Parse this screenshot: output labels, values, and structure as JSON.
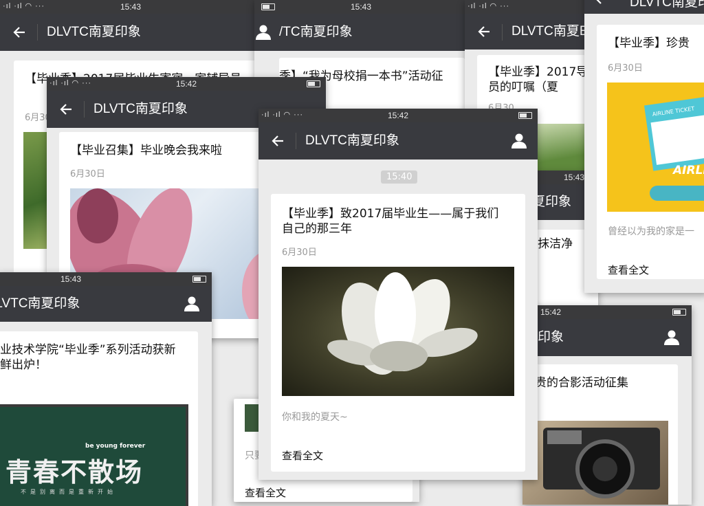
{
  "app": {
    "account_name": "DLVTC南夏印象",
    "account_name_cut": "/TC南夏印象",
    "account_name_cut2": "/LVTC南夏印象",
    "account_name_cut3": "DLVTC南夏E",
    "account_name_cut4": "DLVTC南夏印",
    "account_name_cut5": "夏印象",
    "account_name_cut6": "印象"
  },
  "status_times": {
    "a": "15:43",
    "b": "15:43",
    "c": "15:42",
    "d": "15:42",
    "e": "15:43",
    "f": "15:43",
    "g": "15:42"
  },
  "status_signal": "·ıl ·ıl ◠ ···",
  "main_screen": {
    "message_time": "15:40",
    "article": {
      "title": "【毕业季】致2017届毕业生——属于我们自己的那三年",
      "date": "6月30日",
      "summary": "你和我的夏天~",
      "read_more": "查看全文"
    }
  },
  "screen_left_mid": {
    "article": {
      "title": "【毕业召集】毕业晚会我来啦",
      "date": "6月30日"
    }
  },
  "screen_top_left": {
    "article": {
      "title": "【毕业季】2017届毕业生寄宿一家辅导员",
      "date": "6月30"
    }
  },
  "screen_top_center": {
    "article": {
      "title": "季】“我为母校捐一本书”活动征"
    }
  },
  "screen_top_right": {
    "article": {
      "title": "【毕业季】2017导员的叮嘱（夏",
      "date": "6月30"
    }
  },
  "screen_far_right": {
    "article": {
      "title": "【毕业季】珍贵",
      "date": "6月30日",
      "summary": "曾经以为我的家是一",
      "read_more": "查看全文",
      "ticket_label": "AIRLINE TICKET",
      "ticket_word": "AIRLI"
    }
  },
  "screen_bottom_left": {
    "article": {
      "title": "业技术学院“毕业季”系列活动获新鲜出炉！",
      "board_small": "be young forever",
      "board_big": "青春不散场",
      "board_line": "不是别离而是重新开始"
    }
  },
  "screen_mid_right": {
    "article": {
      "title": "-抹洁净"
    }
  },
  "screen_bottom_right": {
    "article": {
      "title": "贵的合影活动征集"
    }
  },
  "screen_bottom_center": {
    "snippet": "只要",
    "read_more": "查看全文"
  }
}
